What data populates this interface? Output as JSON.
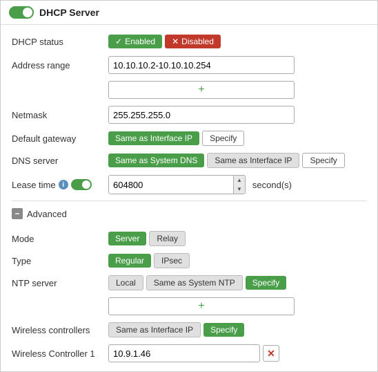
{
  "header": {
    "title": "DHCP Server",
    "toggle_state": "on"
  },
  "dhcp_status": {
    "label": "DHCP status",
    "enabled_label": "Enabled",
    "disabled_label": "Disabled"
  },
  "address_range": {
    "label": "Address range",
    "value": "10.10.10.2-10.10.10.254",
    "add_icon": "+"
  },
  "netmask": {
    "label": "Netmask",
    "value": "255.255.255.0"
  },
  "default_gateway": {
    "label": "Default gateway",
    "same_as_interface_label": "Same as Interface IP",
    "specify_label": "Specify"
  },
  "dns_server": {
    "label": "DNS server",
    "same_as_system_label": "Same as System DNS",
    "same_as_interface_label": "Same as Interface IP",
    "specify_label": "Specify"
  },
  "lease_time": {
    "label": "Lease time",
    "value": "604800",
    "unit": "second(s)"
  },
  "advanced": {
    "label": "Advanced"
  },
  "mode": {
    "label": "Mode",
    "server_label": "Server",
    "relay_label": "Relay"
  },
  "type": {
    "label": "Type",
    "regular_label": "Regular",
    "ipsec_label": "IPsec"
  },
  "ntp_server": {
    "label": "NTP server",
    "local_label": "Local",
    "same_as_system_label": "Same as System NTP",
    "specify_label": "Specify",
    "add_icon": "+"
  },
  "wireless_controllers": {
    "label": "Wireless controllers",
    "same_as_interface_label": "Same as Interface IP",
    "specify_label": "Specify"
  },
  "wireless_controller_1": {
    "label": "Wireless Controller 1",
    "value": "10.9.1.46",
    "delete_icon": "✕"
  },
  "colors": {
    "green": "#4a9e4a",
    "red": "#c0392b",
    "accent": "#5a8fc0"
  }
}
